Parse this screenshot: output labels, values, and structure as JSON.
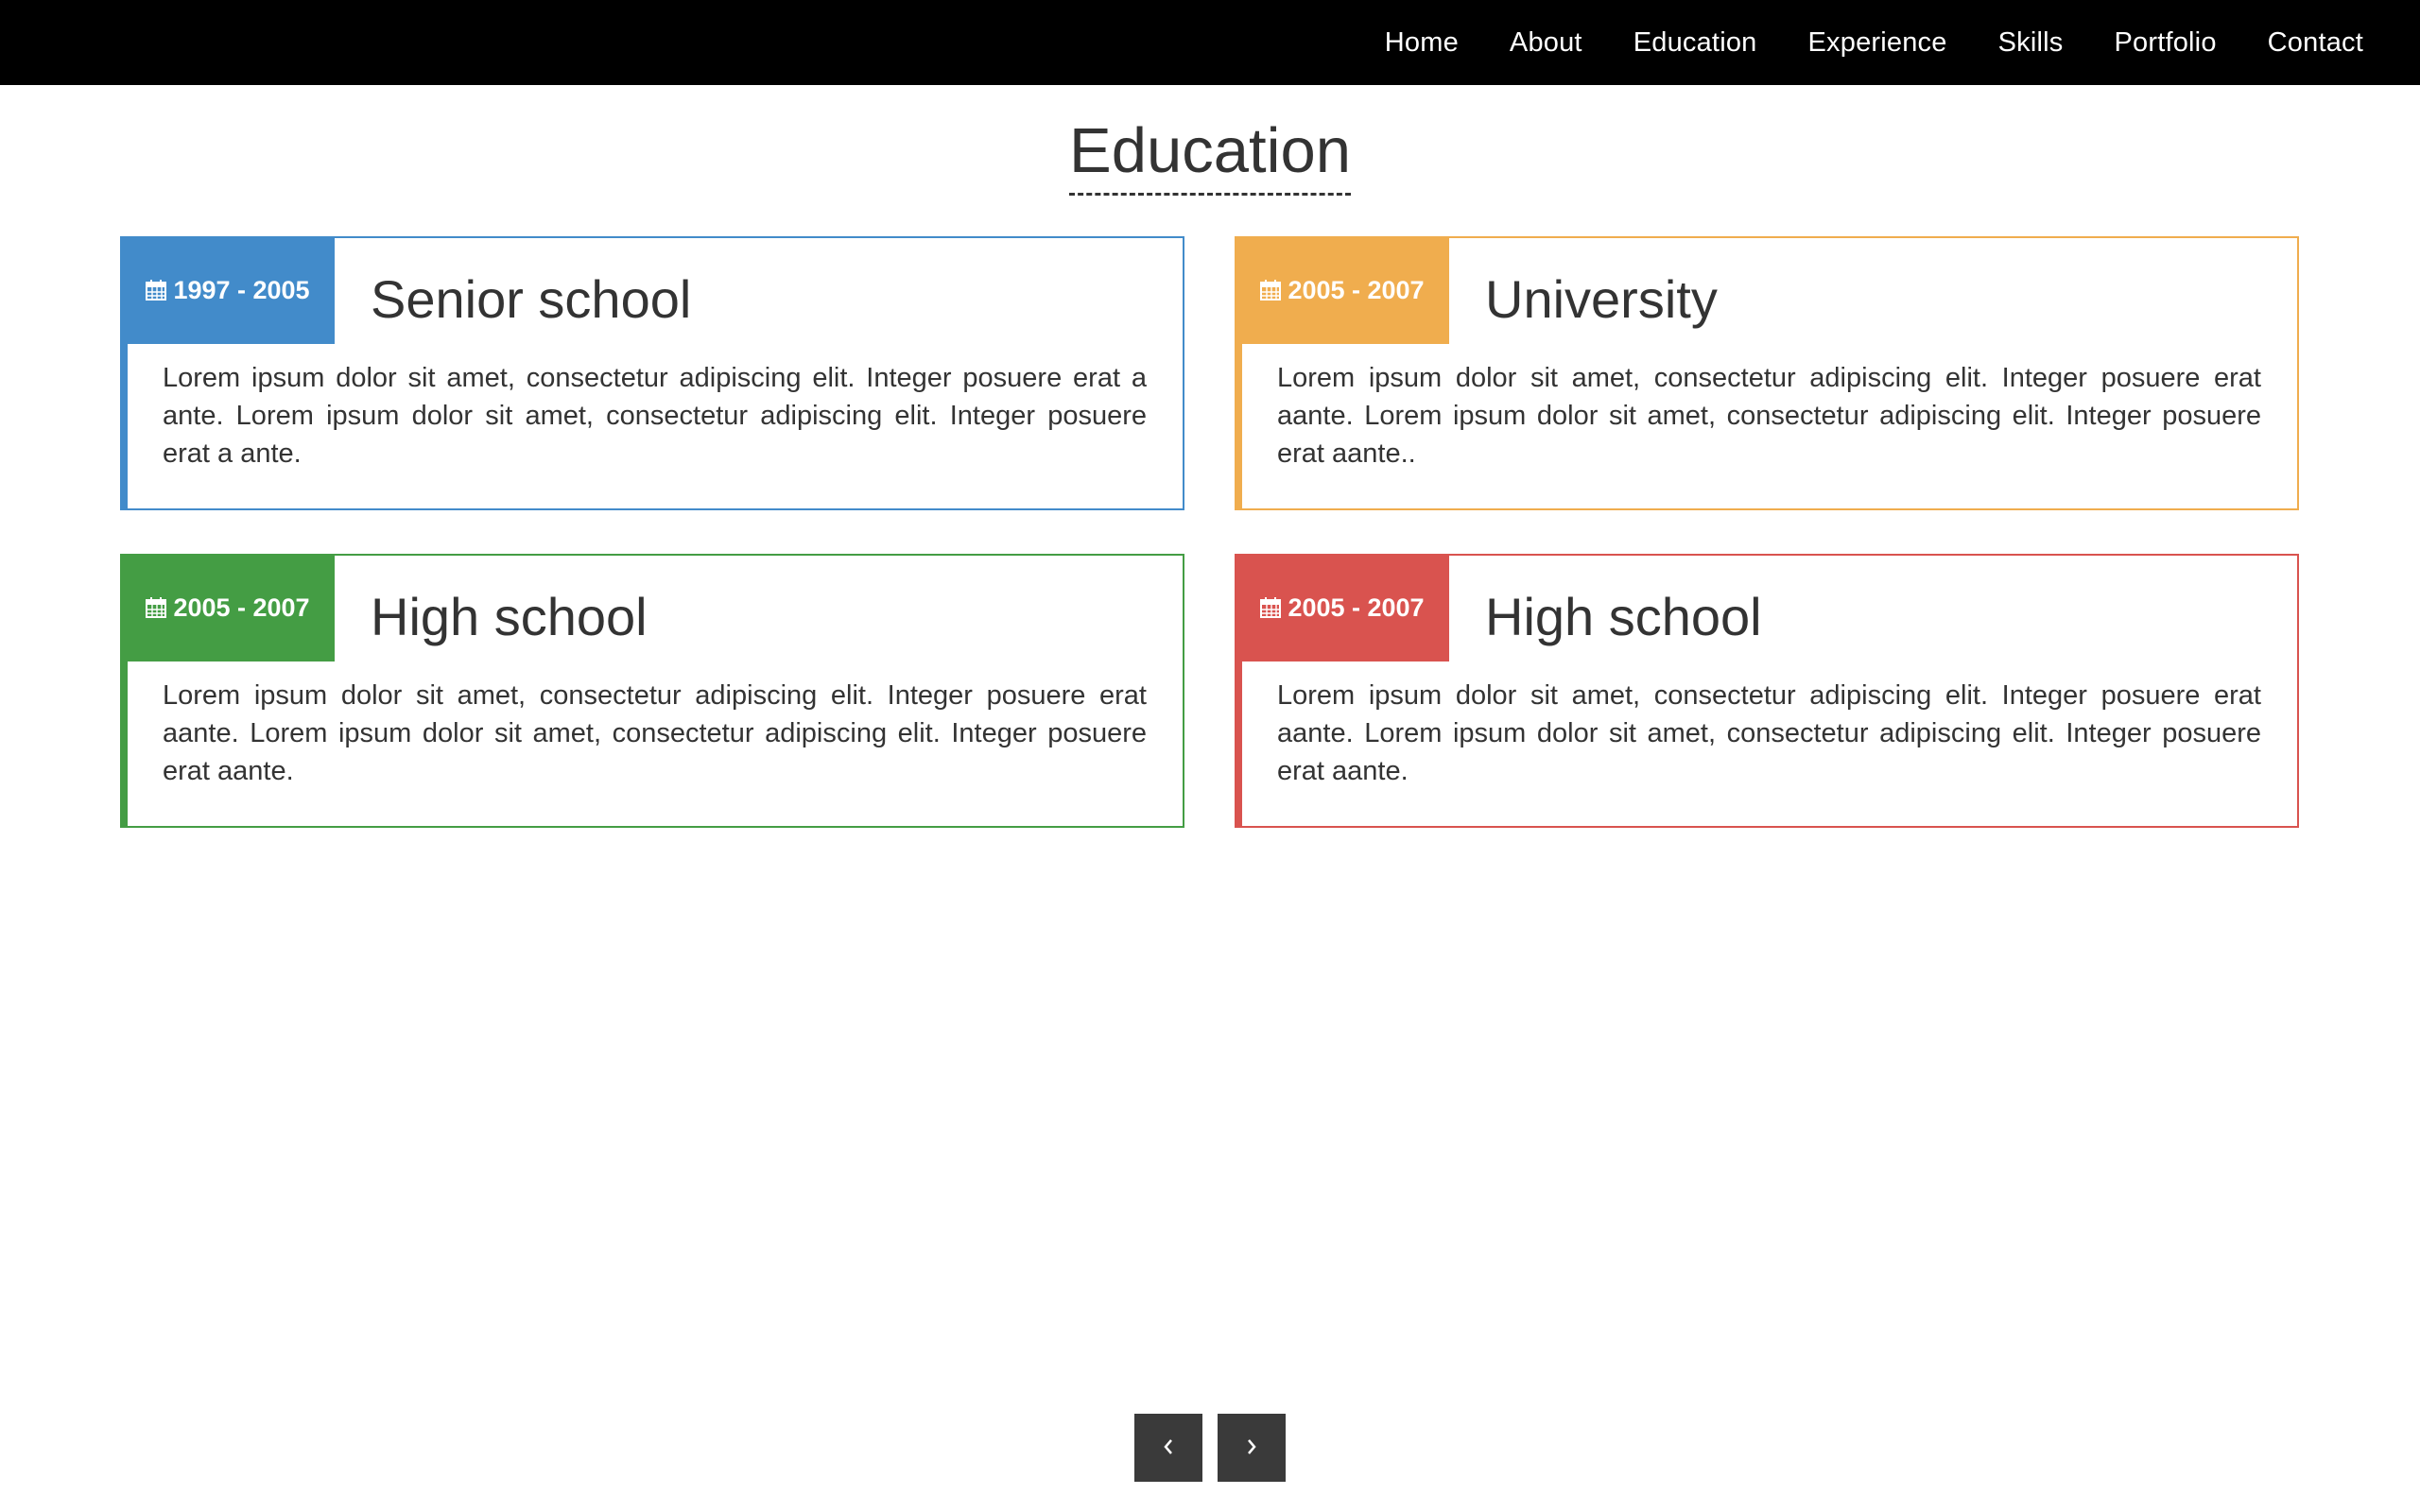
{
  "nav": {
    "items": [
      {
        "label": "Home"
      },
      {
        "label": "About"
      },
      {
        "label": "Education"
      },
      {
        "label": "Experience"
      },
      {
        "label": "Skills"
      },
      {
        "label": "Portfolio"
      },
      {
        "label": "Contact"
      }
    ]
  },
  "section": {
    "title": "Education"
  },
  "cards": [
    {
      "dates": "1997 - 2005",
      "title": "Senior school",
      "text": "Lorem ipsum dolor sit amet, consectetur adipiscing elit. Integer posuere erat a ante. Lorem ipsum dolor sit amet, consectetur adipiscing elit. Integer posuere erat a ante.",
      "color": "#428bca",
      "icon": "calendar-icon"
    },
    {
      "dates": "2005 - 2007",
      "title": "University",
      "text": "Lorem ipsum dolor sit amet, consectetur adipiscing elit. Integer posuere erat aante. Lorem ipsum dolor sit amet, consectetur adipiscing elit. Integer posuere erat aante..",
      "color": "#f0ad4e",
      "icon": "calendar-icon"
    },
    {
      "dates": "2005 - 2007",
      "title": "High school",
      "text": "Lorem ipsum dolor sit amet, consectetur adipiscing elit. Integer posuere erat aante. Lorem ipsum dolor sit amet, consectetur adipiscing elit. Integer posuere erat aante.",
      "color": "#449d44",
      "icon": "calendar-icon"
    },
    {
      "dates": "2005 - 2007",
      "title": "High school",
      "text": "Lorem ipsum dolor sit amet, consectetur adipiscing elit. Integer posuere erat aante. Lorem ipsum dolor sit amet, consectetur adipiscing elit. Integer posuere erat aante.",
      "color": "#d9534f",
      "icon": "calendar-icon"
    }
  ],
  "pager": {
    "prev_icon": "chevron-left-icon",
    "next_icon": "chevron-right-icon",
    "button_color": "#3a3a3a"
  }
}
